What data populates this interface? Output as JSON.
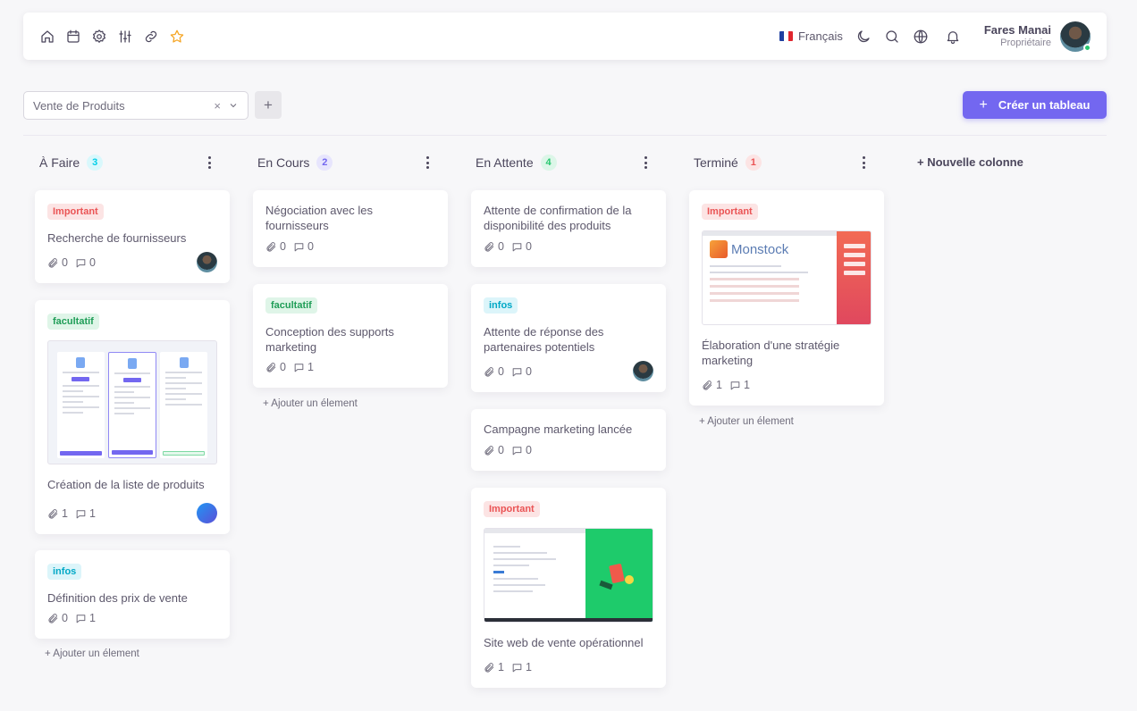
{
  "header": {
    "language": "Français",
    "user_name": "Fares Manai",
    "user_role": "Propriétaire"
  },
  "toolbar": {
    "board_select_value": "Vente de Produits",
    "clear_symbol": "×",
    "add_symbol": "+",
    "create_label": "Créer un tableau",
    "create_icon": "+"
  },
  "new_column_label": "+ Nouvelle colonne",
  "add_item_label": "+ Ajouter un élement",
  "columns": [
    {
      "title": "À Faire",
      "count": "3",
      "badge_color": "#00cfe8",
      "badge_bg": "#d9f8fc",
      "cards": [
        {
          "tag": "Important",
          "title": "Recherche de fournisseurs",
          "attachments": "0",
          "comments": "0"
        },
        {
          "tag": "facultatif",
          "title": "Création de la liste de produits",
          "attachments": "1",
          "comments": "1"
        },
        {
          "tag": "infos",
          "title": "Définition des prix de vente",
          "attachments": "0",
          "comments": "1"
        }
      ]
    },
    {
      "title": "En Cours",
      "count": "2",
      "badge_color": "#7367f0",
      "badge_bg": "#e7e5fd",
      "cards": [
        {
          "title": "Négociation avec les fournisseurs",
          "attachments": "0",
          "comments": "0"
        },
        {
          "tag": "facultatif",
          "title": "Conception des supports marketing",
          "attachments": "0",
          "comments": "1"
        }
      ]
    },
    {
      "title": "En Attente",
      "count": "4",
      "badge_color": "#28c76f",
      "badge_bg": "#dcf6e8",
      "cards": [
        {
          "title": "Attente de confirmation de la disponibilité des produits",
          "attachments": "0",
          "comments": "0"
        },
        {
          "tag": "infos",
          "title": "Attente de réponse des partenaires potentiels",
          "attachments": "0",
          "comments": "0"
        },
        {
          "title": "Campagne marketing lancée",
          "attachments": "0",
          "comments": "0"
        },
        {
          "tag": "Important",
          "title": "Site web de vente opérationnel",
          "attachments": "1",
          "comments": "1"
        }
      ]
    },
    {
      "title": "Terminé",
      "count": "1",
      "badge_color": "#ea5455",
      "badge_bg": "#fce4e4",
      "cards": [
        {
          "tag": "Important",
          "title": "Élaboration d'une stratégie marketing",
          "attachments": "1",
          "comments": "1"
        }
      ]
    }
  ],
  "thumbnails": {
    "monstock_brand": "Monstock"
  },
  "colors": {
    "primary": "#7367f0",
    "important": "#ea5455",
    "facultatif": "#28c76f",
    "infos": "#00cfe8"
  }
}
